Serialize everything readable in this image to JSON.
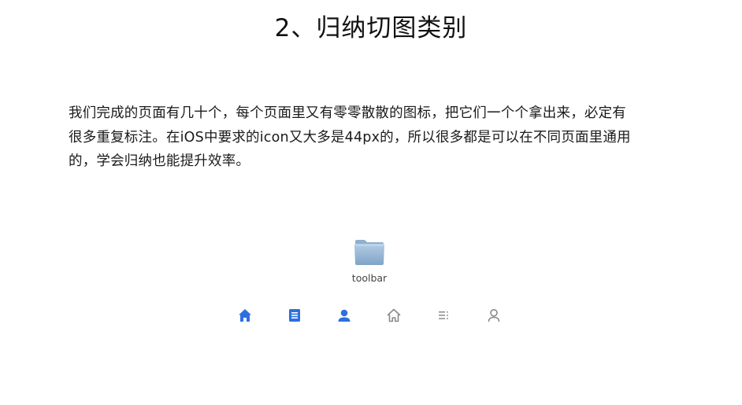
{
  "title": "2、归纳切图类别",
  "paragraph": {
    "lines": [
      "我们完成的页面有几十个，每个页面里又有零零散散的图标，把它们一个个拿出来，必定有",
      "很多重复标注。在iOS中要求的icon又大多是44px的，所以很多都是可以在不同页面里通用",
      "的，学会归纳也能提升效率。"
    ]
  },
  "illustration": {
    "folder_icon": "folder-icon",
    "caption": "toolbar",
    "icons": [
      {
        "name": "home-icon",
        "state": "active",
        "color": "#2d6fe0"
      },
      {
        "name": "list-icon",
        "state": "active",
        "color": "#2d6fe0"
      },
      {
        "name": "user-icon",
        "state": "active",
        "color": "#2d6fe0"
      },
      {
        "name": "home-outline-icon",
        "state": "inactive",
        "color": "#8a8a8a"
      },
      {
        "name": "list-outline-icon",
        "state": "inactive",
        "color": "#8a8a8a"
      },
      {
        "name": "user-outline-icon",
        "state": "inactive",
        "color": "#8a8a8a"
      }
    ]
  },
  "colors": {
    "active": "#2d6fe0",
    "inactive": "#8a8a8a",
    "folder": "#8fb3d4"
  }
}
